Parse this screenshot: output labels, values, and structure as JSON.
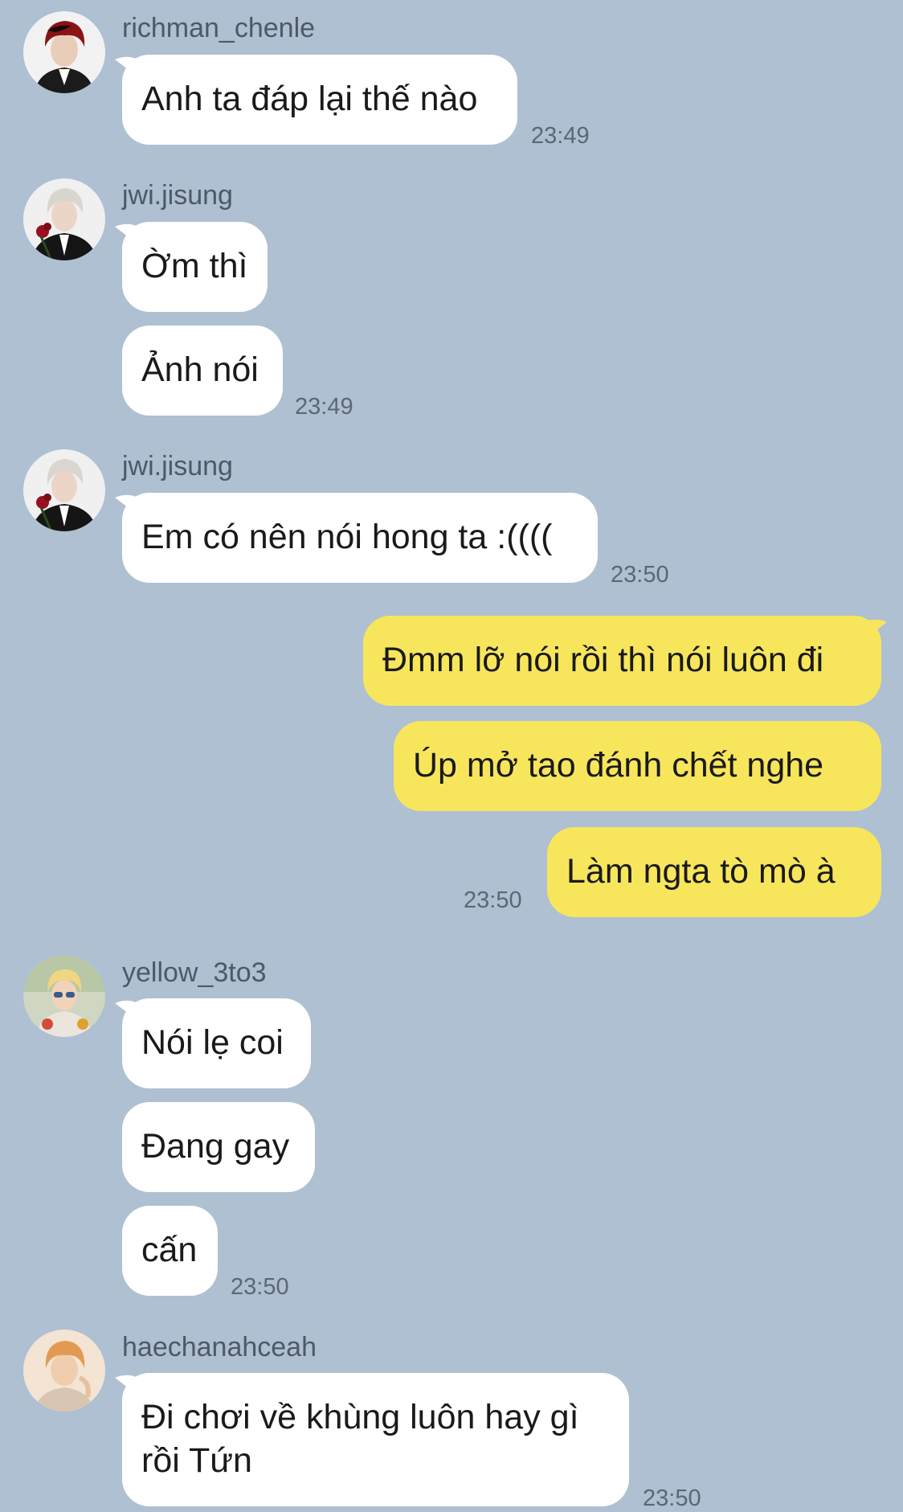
{
  "messages": [
    {
      "sender": "richman_chenle",
      "texts": [
        "Anh ta đáp lại thế nào"
      ],
      "time": "23:49"
    },
    {
      "sender": "jwi.jisung",
      "texts": [
        "Ờm thì",
        "Ảnh nói"
      ],
      "time": "23:49"
    },
    {
      "sender": "jwi.jisung",
      "texts": [
        "Em có nên nói hong ta :(((("
      ],
      "time": "23:50"
    },
    {
      "sender": "me",
      "texts": [
        "Đmm lỡ nói rồi thì nói luôn đi",
        "Úp mở tao đánh chết nghe",
        "Làm ngta tò mò à"
      ],
      "time": "23:50"
    },
    {
      "sender": "yellow_3to3",
      "texts": [
        "Nói lẹ coi",
        "Đang gay",
        "cấn"
      ],
      "time": "23:50"
    },
    {
      "sender": "haechanahceah",
      "texts": [
        "Đi chơi về khùng luôn hay gì rồi Tứn"
      ],
      "time": "23:50"
    }
  ],
  "colors": {
    "background": "#aec0d2",
    "incoming_bubble": "#ffffff",
    "outgoing_bubble": "#f7e65c",
    "username": "#4f5966",
    "timestamp": "#5d6773"
  },
  "icons": [
    "avatar-richman-chenle-icon",
    "avatar-jwi-jisung-icon",
    "avatar-yellow-3to3-icon",
    "avatar-haechanahceah-icon"
  ]
}
